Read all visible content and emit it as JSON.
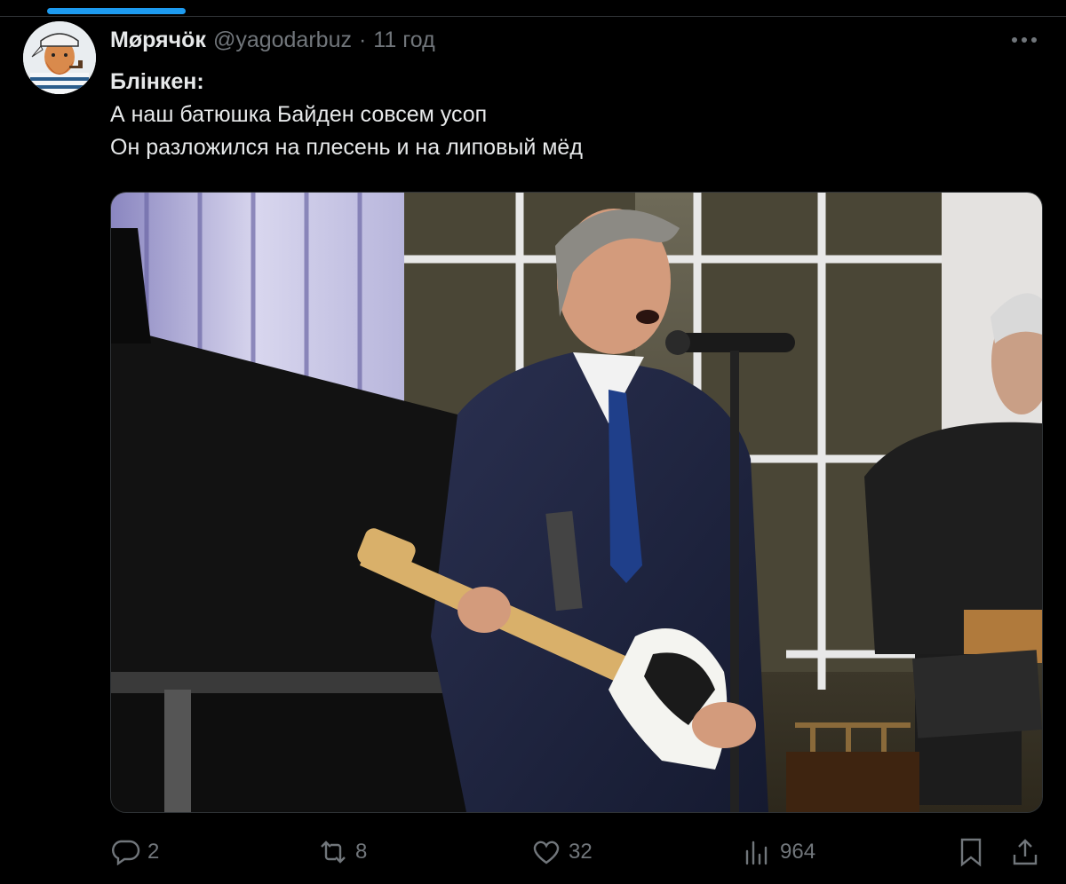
{
  "tweet": {
    "author_name": "Мøрячӧк",
    "handle": "@yagodarbuz",
    "separator": "·",
    "time": "11 год",
    "text_lines": [
      "Блінкен:",
      "А наш батюшка Байден совсем усоп",
      "Он разложился на плесень и на липовый мёд"
    ]
  },
  "actions": {
    "replies": "2",
    "reposts": "8",
    "likes": "32",
    "views": "964"
  },
  "colors": {
    "background": "#000000",
    "text_primary": "#e7e9ea",
    "text_secondary": "#71767b",
    "accent": "#1d9bf0",
    "border": "#2f3336"
  },
  "icons": [
    "more-icon",
    "reply-icon",
    "repost-icon",
    "like-icon",
    "views-icon",
    "bookmark-icon",
    "share-icon"
  ]
}
